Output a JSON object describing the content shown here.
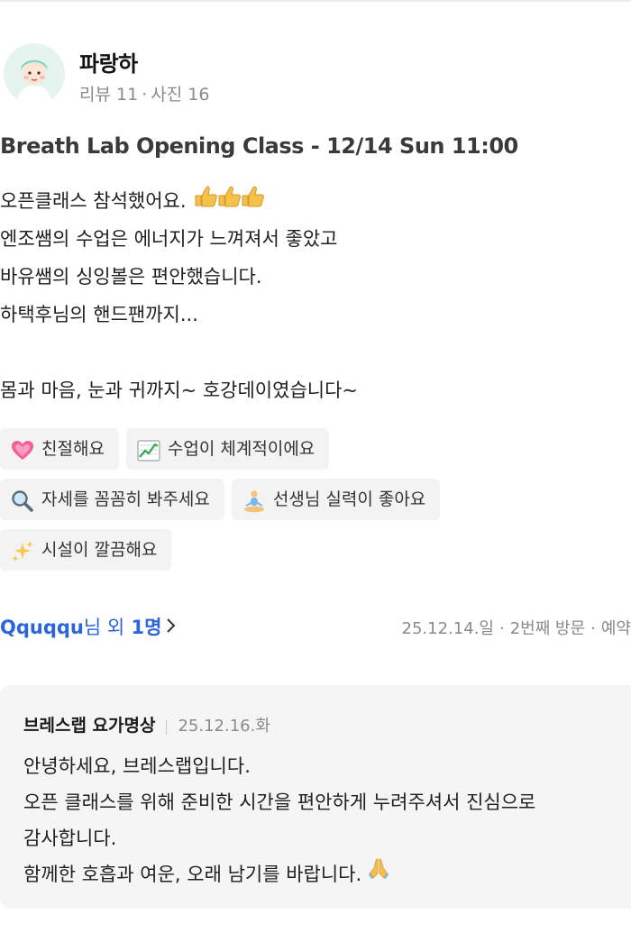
{
  "user": {
    "name": "파랑하",
    "reviews": "리뷰 11",
    "photos": "사진 16"
  },
  "review": {
    "title": "Breath Lab Opening Class - 12/14 Sun 11:00",
    "lines": [
      "오픈클래스 참석했어요.",
      "엔조쌤의 수업은 에너지가 느껴져서 좋았고",
      "바유쌤의 싱잉볼은 편안했습니다.",
      "하택후님의 핸드팬까지...",
      "",
      "몸과 마음, 눈과 귀까지~ 호강데이였습니다~"
    ]
  },
  "tags": [
    {
      "label": "친절해요",
      "icon": "heart-emoji"
    },
    {
      "label": "수업이 체계적이에요",
      "icon": "chart-emoji"
    },
    {
      "label": "자세를 꼼꼼히 봐주세요",
      "icon": "magnifier-emoji"
    },
    {
      "label": "선생님 실력이 좋아요",
      "icon": "meditation-emoji"
    },
    {
      "label": "시설이 깔끔해요",
      "icon": "sparkles-emoji"
    }
  ],
  "footer": {
    "liker_name": "Qquqqu",
    "liker_suffix": "님 외",
    "liker_count": "1명",
    "date": "25.12.14.일",
    "visit": "2번째 방문",
    "type": "예약"
  },
  "reply": {
    "author": "브레스랩 요가명상",
    "date": "25.12.16.화",
    "lines": [
      "안녕하세요, 브레스랩입니다.",
      "오픈 클래스를 위해 준비한 시간을 편안하게 누려주셔서 진심으로",
      "감사합니다.",
      "함께한 호흡과 여운, 오래 남기를 바랍니다."
    ]
  }
}
